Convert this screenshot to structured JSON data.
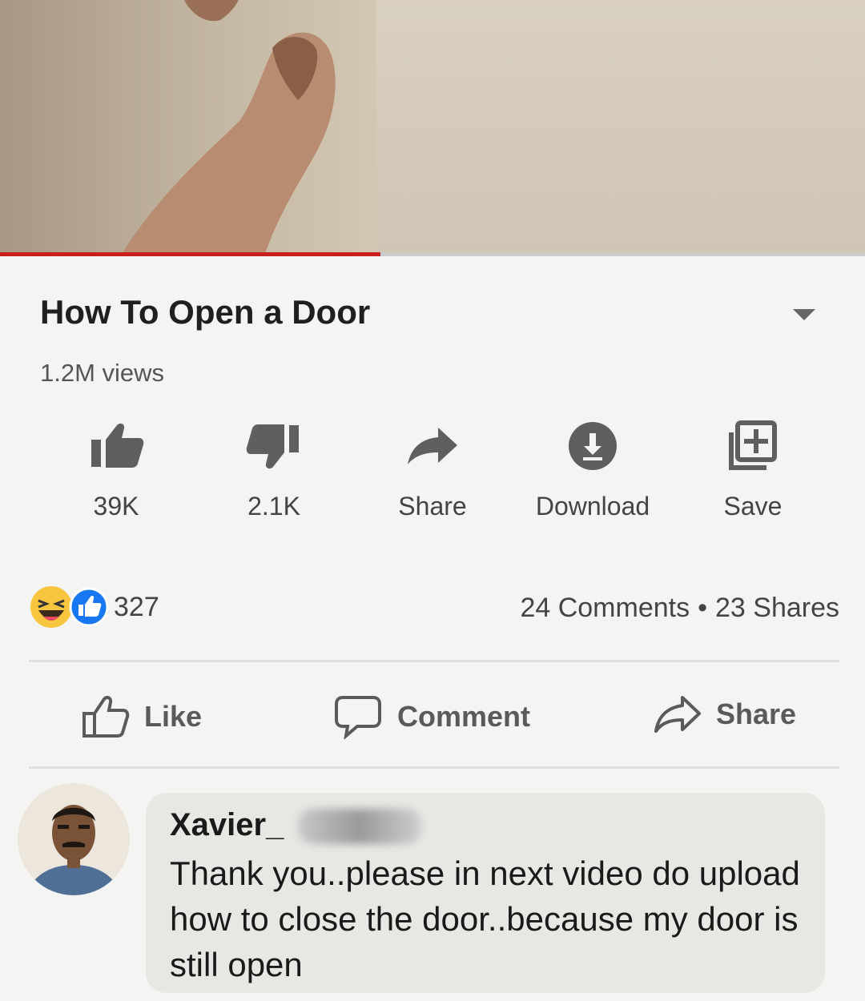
{
  "video": {
    "progress_fraction": 0.44,
    "progress_color": "#c81e1e"
  },
  "title": "How To Open a Door",
  "views": "1.2M views",
  "actions": [
    {
      "icon": "thumbs-up-icon",
      "label": "39K"
    },
    {
      "icon": "thumbs-down-icon",
      "label": "2.1K"
    },
    {
      "icon": "share-arrow-icon",
      "label": "Share"
    },
    {
      "icon": "download-icon",
      "label": "Download"
    },
    {
      "icon": "save-playlist-icon",
      "label": "Save"
    }
  ],
  "reactions": {
    "icons": [
      "haha-reaction-icon",
      "like-reaction-icon"
    ],
    "count": "327"
  },
  "stats": {
    "comments": "24 Comments",
    "separator": "•",
    "shares": "23 Shares"
  },
  "fb_actions": [
    {
      "icon": "like-outline-icon",
      "label": "Like"
    },
    {
      "icon": "comment-outline-icon",
      "label": "Comment"
    },
    {
      "icon": "share-outline-icon",
      "label": "Share"
    }
  ],
  "comment": {
    "author": "Xavier_",
    "text": "Thank you..please in next video do upload how to close the door..because my door is still open"
  },
  "colors": {
    "like_blue": "#1877f2",
    "haha_yellow": "#f7c53e",
    "icon_gray": "#5f5f5f",
    "bubble_bg": "#e6e8e4"
  }
}
